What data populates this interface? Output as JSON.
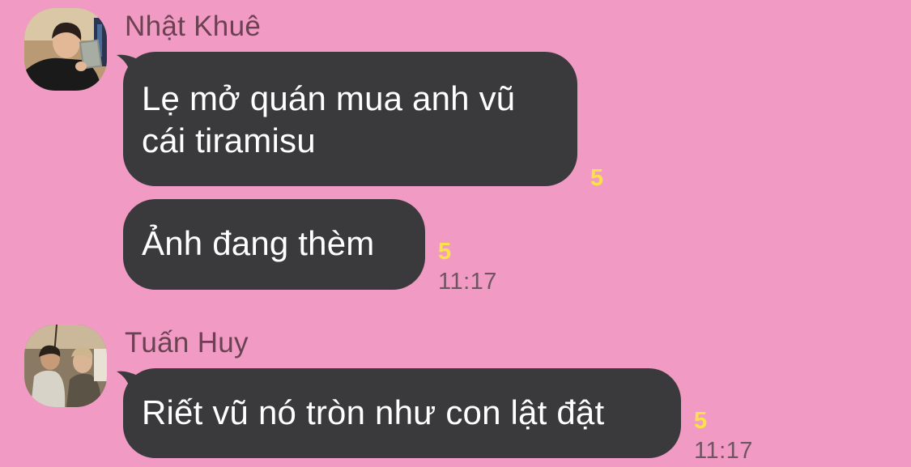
{
  "theme": {
    "background": "#f19bc4",
    "bubble_color": "#3a3a3c",
    "bubble_text_color": "#ffffff",
    "read_count_color": "#fbe14a",
    "timestamp_color": "#6e5561",
    "name_color": "#6b4252"
  },
  "messages": [
    {
      "sender": "Nhật Khuê",
      "avatar_icon": "person-reading-book-avatar",
      "text": "Lẹ mở quán mua anh vũ\ncái tiramisu",
      "read_count": "5"
    },
    {
      "text": "Ảnh đang thèm",
      "read_count": "5",
      "time": "11:17"
    },
    {
      "sender": "Tuấn Huy",
      "avatar_icon": "two-people-photo-avatar",
      "text": "Riết vũ nó tròn như con lật đật",
      "read_count": "5",
      "time": "11:17"
    }
  ]
}
